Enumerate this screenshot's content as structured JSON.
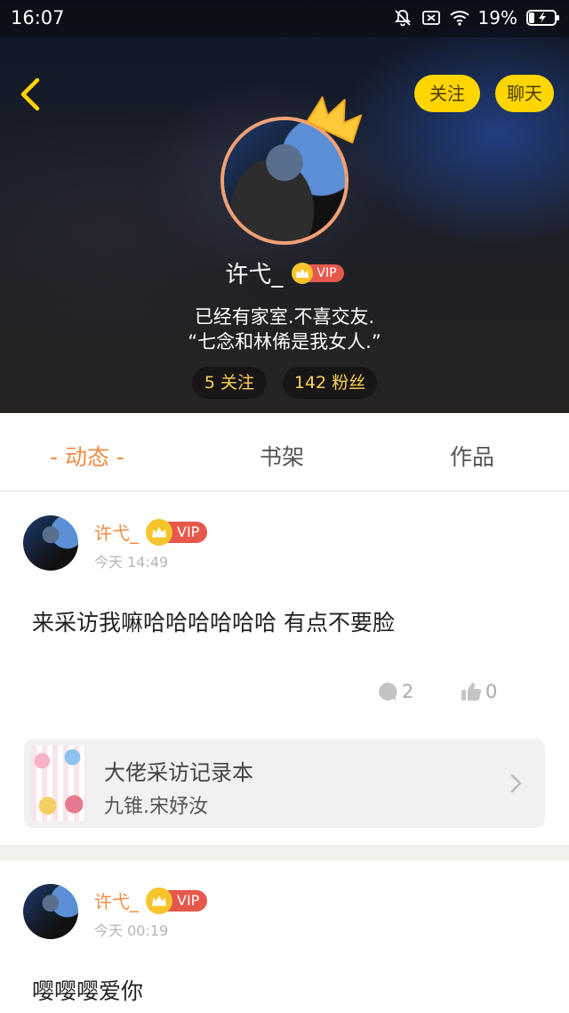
{
  "status": {
    "time": "16:07",
    "battery": "19%"
  },
  "header": {
    "follow_label": "关注",
    "chat_label": "聊天",
    "username": "许弋_",
    "vip_label": "VIP",
    "bio_line1": "已经有家室.不喜交友.",
    "bio_line2": "“七念和林俙是我女人.”",
    "following": "5 关注",
    "fans": "142 粉丝"
  },
  "tabs": [
    {
      "label": "- 动态 -",
      "active": true
    },
    {
      "label": "书架",
      "active": false
    },
    {
      "label": "作品",
      "active": false
    }
  ],
  "posts": [
    {
      "author": "许弋_",
      "vip": "VIP",
      "time": "今天 14:49",
      "text": "来采访我嘛哈哈哈哈哈哈 有点不要脸",
      "comments": "2",
      "likes": "0",
      "book": {
        "title": "大佬采访记录本",
        "author": "九锥.宋妤汝"
      }
    },
    {
      "author": "许弋_",
      "vip": "VIP",
      "time": "今天 00:19",
      "text": "嘤嘤嘤爱你"
    }
  ],
  "colors": {
    "accent": "#f08a42",
    "button_yellow": "#ffd500",
    "vip_red": "#e6584c",
    "crown_gold": "#f7c52b"
  }
}
